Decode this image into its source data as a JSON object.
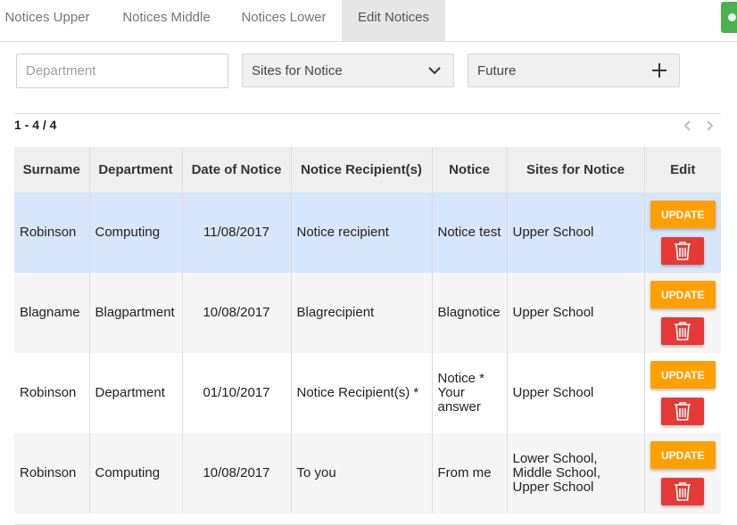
{
  "tabs": [
    {
      "label": "Notices Upper",
      "active": false
    },
    {
      "label": "Notices Middle",
      "active": false
    },
    {
      "label": "Notices Lower",
      "active": false
    },
    {
      "label": "Edit Notices",
      "active": true
    }
  ],
  "filters": {
    "department_placeholder": "Department",
    "sites_label": "Sites for Notice",
    "future_label": "Future"
  },
  "pager": {
    "range_text": "1 - 4 / 4"
  },
  "table": {
    "headers": [
      "Surname",
      "Department",
      "Date of Notice",
      "Notice Recipient(s)",
      "Notice",
      "Sites for Notice",
      "Edit"
    ],
    "rows": [
      {
        "surname": "Robinson",
        "department": "Computing",
        "date": "11/08/2017",
        "recipient": "Notice recipient",
        "notice": "Notice test",
        "sites": "Upper School",
        "update_label": "UPDATE",
        "selected": true
      },
      {
        "surname": "Blagname",
        "department": "Blagpartment",
        "date": "10/08/2017",
        "recipient": "Blagrecipient",
        "notice": "Blagnotice",
        "sites": "Upper School",
        "update_label": "UPDATE",
        "selected": false
      },
      {
        "surname": "Robinson",
        "department": "Department",
        "date": "01/10/2017",
        "recipient": "Notice Recipient(s) *",
        "notice": "Notice * Your answer",
        "sites": "Upper School",
        "update_label": "UPDATE",
        "selected": false
      },
      {
        "surname": "Robinson",
        "department": "Computing",
        "date": "10/08/2017",
        "recipient": "To you",
        "notice": "From me",
        "sites": "Lower School, Middle School, Upper School",
        "update_label": "UPDATE",
        "selected": false
      }
    ]
  },
  "colors": {
    "update_button": "#ffa000",
    "delete_button": "#e53935",
    "selected_row": "#d7e6fb",
    "active_tab": "#e6e6e6"
  },
  "icons": {
    "sites_dropdown": "chevron-down-icon",
    "future_add": "plus-icon",
    "pager_prev": "chevron-left-icon",
    "pager_next": "chevron-right-icon",
    "delete": "trash-icon"
  }
}
